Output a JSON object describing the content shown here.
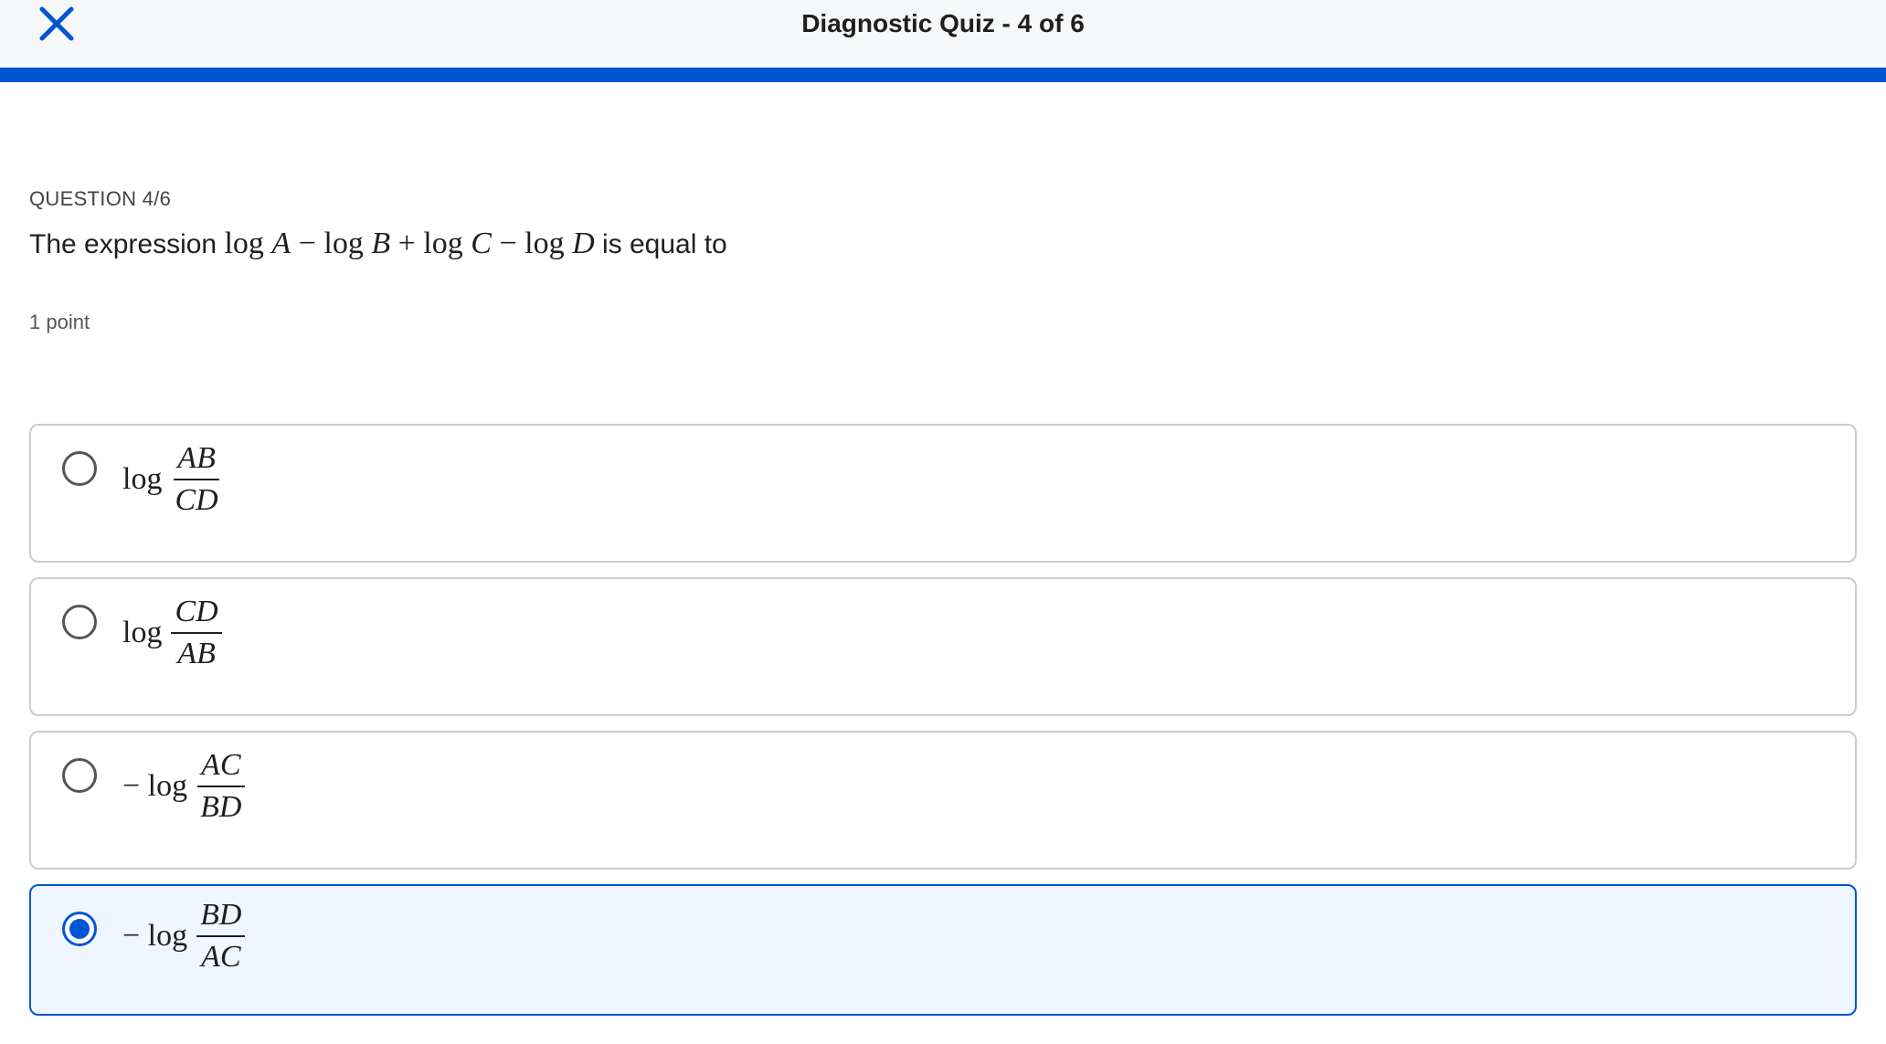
{
  "header": {
    "close_icon": "close-icon",
    "title": "Diagnostic Quiz - 4 of 6",
    "accent_color": "#0056d2",
    "progress_fraction": 1.0
  },
  "question": {
    "label": "QUESTION 4/6",
    "text_before": "The expression",
    "expression": {
      "t1": "log ",
      "v1": "A",
      "op1": " − ",
      "t2": "log ",
      "v2": "B",
      "op2": " + ",
      "t3": "log ",
      "v3": "C",
      "op3": " − ",
      "t4": "log ",
      "v4": "D"
    },
    "text_after": "is equal to",
    "points": "1 point"
  },
  "options": [
    {
      "prefix": "log",
      "numerator": "AB",
      "denominator": "CD",
      "selected": false
    },
    {
      "prefix": "log",
      "numerator": "CD",
      "denominator": "AB",
      "selected": false
    },
    {
      "prefix": "− log",
      "numerator": "AC",
      "denominator": "BD",
      "selected": false
    },
    {
      "prefix": "− log",
      "numerator": "BD",
      "denominator": "AC",
      "selected": true
    }
  ]
}
